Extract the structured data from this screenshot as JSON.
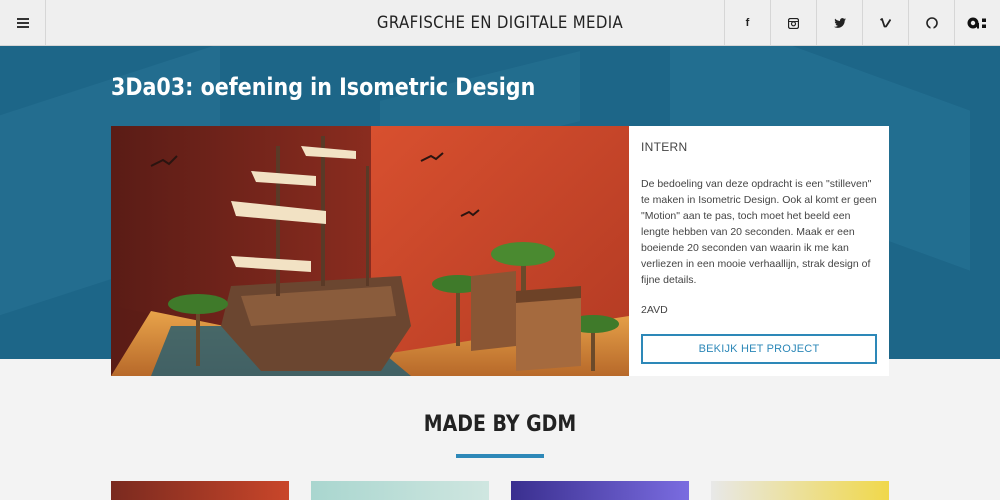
{
  "nav": {
    "site_title": "GRAFISCHE EN DIGITALE MEDIA",
    "social": [
      {
        "name": "facebook-icon",
        "glyph": "f"
      },
      {
        "name": "instagram-icon",
        "glyph": ""
      },
      {
        "name": "twitter-icon",
        "glyph": ""
      },
      {
        "name": "vimeo-icon",
        "glyph": ""
      },
      {
        "name": "github-icon",
        "glyph": ""
      },
      {
        "name": "brand-logo-icon",
        "glyph": ""
      }
    ]
  },
  "hero": {
    "title": "3Da03: oefening in Isometric Design"
  },
  "project": {
    "tag": "INTERN",
    "description": "De bedoeling van deze opdracht is een \"stilleven\" te maken in Isometric Design. Ook al komt er geen \"Motion\" aan te pas, toch moet het beeld een lengte hebben van 20 seconden. Maak er een boeiende 20 seconden van waarin ik me kan verliezen in een mooie verhaallijn, strak design of fijne details.",
    "class": "2AVD",
    "button_label": "BEKIJK HET PROJECT"
  },
  "section": {
    "title": "MADE BY GDM"
  },
  "colors": {
    "accent": "#2d88b8",
    "hero_bg": "#1d6688",
    "nav_bg": "#efefef"
  }
}
